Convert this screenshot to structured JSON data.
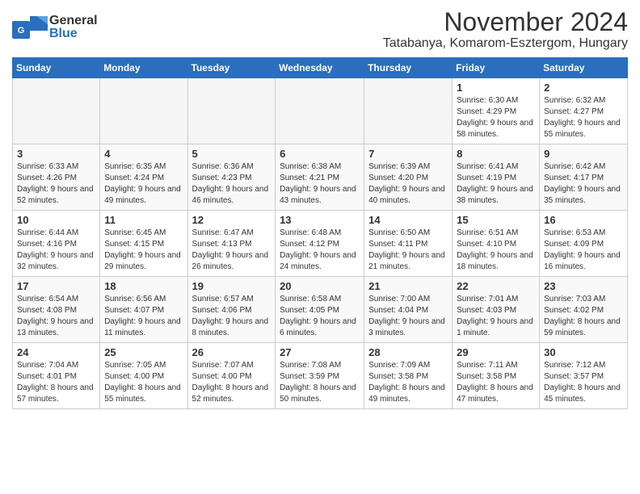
{
  "header": {
    "logo_line1": "General",
    "logo_line2": "Blue",
    "title": "November 2024",
    "subtitle": "Tatabanya, Komarom-Esztergom, Hungary"
  },
  "weekdays": [
    "Sunday",
    "Monday",
    "Tuesday",
    "Wednesday",
    "Thursday",
    "Friday",
    "Saturday"
  ],
  "weeks": [
    [
      {
        "day": "",
        "info": ""
      },
      {
        "day": "",
        "info": ""
      },
      {
        "day": "",
        "info": ""
      },
      {
        "day": "",
        "info": ""
      },
      {
        "day": "",
        "info": ""
      },
      {
        "day": "1",
        "info": "Sunrise: 6:30 AM\nSunset: 4:29 PM\nDaylight: 9 hours and 58 minutes."
      },
      {
        "day": "2",
        "info": "Sunrise: 6:32 AM\nSunset: 4:27 PM\nDaylight: 9 hours and 55 minutes."
      }
    ],
    [
      {
        "day": "3",
        "info": "Sunrise: 6:33 AM\nSunset: 4:26 PM\nDaylight: 9 hours and 52 minutes."
      },
      {
        "day": "4",
        "info": "Sunrise: 6:35 AM\nSunset: 4:24 PM\nDaylight: 9 hours and 49 minutes."
      },
      {
        "day": "5",
        "info": "Sunrise: 6:36 AM\nSunset: 4:23 PM\nDaylight: 9 hours and 46 minutes."
      },
      {
        "day": "6",
        "info": "Sunrise: 6:38 AM\nSunset: 4:21 PM\nDaylight: 9 hours and 43 minutes."
      },
      {
        "day": "7",
        "info": "Sunrise: 6:39 AM\nSunset: 4:20 PM\nDaylight: 9 hours and 40 minutes."
      },
      {
        "day": "8",
        "info": "Sunrise: 6:41 AM\nSunset: 4:19 PM\nDaylight: 9 hours and 38 minutes."
      },
      {
        "day": "9",
        "info": "Sunrise: 6:42 AM\nSunset: 4:17 PM\nDaylight: 9 hours and 35 minutes."
      }
    ],
    [
      {
        "day": "10",
        "info": "Sunrise: 6:44 AM\nSunset: 4:16 PM\nDaylight: 9 hours and 32 minutes."
      },
      {
        "day": "11",
        "info": "Sunrise: 6:45 AM\nSunset: 4:15 PM\nDaylight: 9 hours and 29 minutes."
      },
      {
        "day": "12",
        "info": "Sunrise: 6:47 AM\nSunset: 4:13 PM\nDaylight: 9 hours and 26 minutes."
      },
      {
        "day": "13",
        "info": "Sunrise: 6:48 AM\nSunset: 4:12 PM\nDaylight: 9 hours and 24 minutes."
      },
      {
        "day": "14",
        "info": "Sunrise: 6:50 AM\nSunset: 4:11 PM\nDaylight: 9 hours and 21 minutes."
      },
      {
        "day": "15",
        "info": "Sunrise: 6:51 AM\nSunset: 4:10 PM\nDaylight: 9 hours and 18 minutes."
      },
      {
        "day": "16",
        "info": "Sunrise: 6:53 AM\nSunset: 4:09 PM\nDaylight: 9 hours and 16 minutes."
      }
    ],
    [
      {
        "day": "17",
        "info": "Sunrise: 6:54 AM\nSunset: 4:08 PM\nDaylight: 9 hours and 13 minutes."
      },
      {
        "day": "18",
        "info": "Sunrise: 6:56 AM\nSunset: 4:07 PM\nDaylight: 9 hours and 11 minutes."
      },
      {
        "day": "19",
        "info": "Sunrise: 6:57 AM\nSunset: 4:06 PM\nDaylight: 9 hours and 8 minutes."
      },
      {
        "day": "20",
        "info": "Sunrise: 6:58 AM\nSunset: 4:05 PM\nDaylight: 9 hours and 6 minutes."
      },
      {
        "day": "21",
        "info": "Sunrise: 7:00 AM\nSunset: 4:04 PM\nDaylight: 9 hours and 3 minutes."
      },
      {
        "day": "22",
        "info": "Sunrise: 7:01 AM\nSunset: 4:03 PM\nDaylight: 9 hours and 1 minute."
      },
      {
        "day": "23",
        "info": "Sunrise: 7:03 AM\nSunset: 4:02 PM\nDaylight: 8 hours and 59 minutes."
      }
    ],
    [
      {
        "day": "24",
        "info": "Sunrise: 7:04 AM\nSunset: 4:01 PM\nDaylight: 8 hours and 57 minutes."
      },
      {
        "day": "25",
        "info": "Sunrise: 7:05 AM\nSunset: 4:00 PM\nDaylight: 8 hours and 55 minutes."
      },
      {
        "day": "26",
        "info": "Sunrise: 7:07 AM\nSunset: 4:00 PM\nDaylight: 8 hours and 52 minutes."
      },
      {
        "day": "27",
        "info": "Sunrise: 7:08 AM\nSunset: 3:59 PM\nDaylight: 8 hours and 50 minutes."
      },
      {
        "day": "28",
        "info": "Sunrise: 7:09 AM\nSunset: 3:58 PM\nDaylight: 8 hours and 49 minutes."
      },
      {
        "day": "29",
        "info": "Sunrise: 7:11 AM\nSunset: 3:58 PM\nDaylight: 8 hours and 47 minutes."
      },
      {
        "day": "30",
        "info": "Sunrise: 7:12 AM\nSunset: 3:57 PM\nDaylight: 8 hours and 45 minutes."
      }
    ]
  ]
}
